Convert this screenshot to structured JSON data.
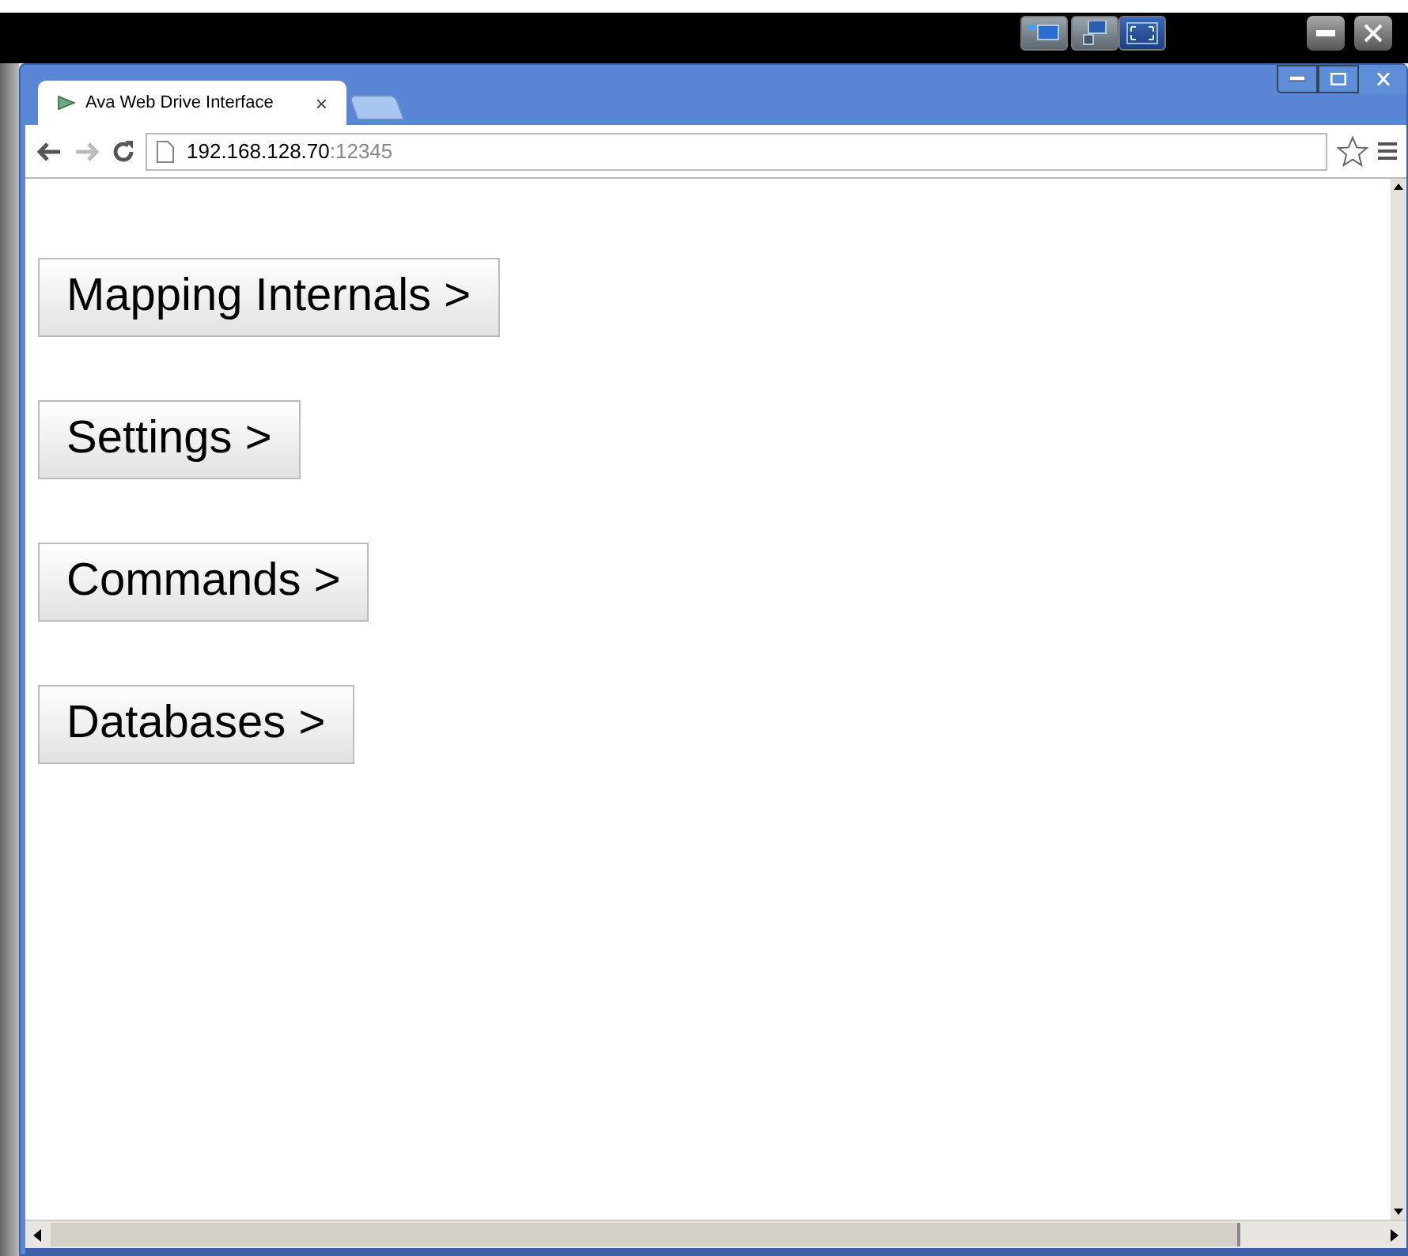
{
  "tab": {
    "title": "Ava Web Drive Interface",
    "close": "×"
  },
  "address": {
    "host": "192.168.128.70",
    "port": ":12345"
  },
  "menu_buttons": [
    {
      "label": "Mapping Internals >"
    },
    {
      "label": "Settings >"
    },
    {
      "label": "Commands >"
    },
    {
      "label": "Databases >"
    }
  ]
}
